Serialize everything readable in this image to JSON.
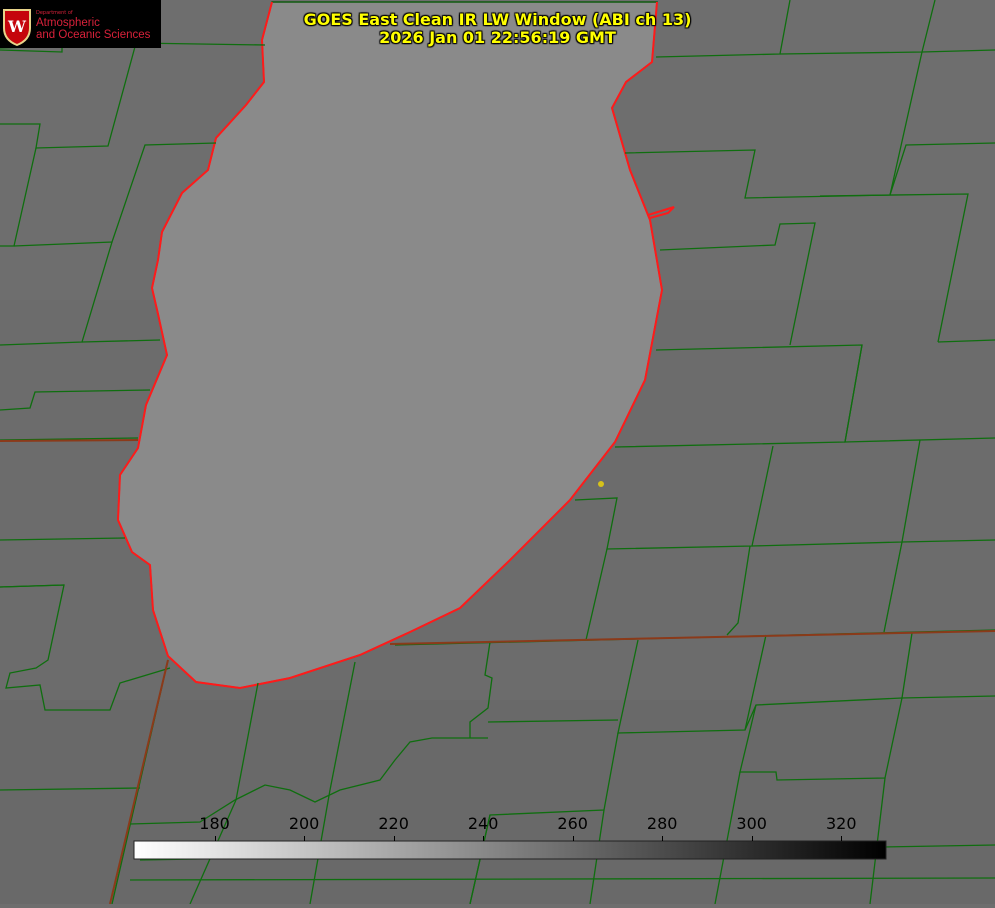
{
  "title": {
    "line1": "GOES East Clean IR LW Window (ABI ch 13)",
    "line2": "2026 Jan 01 22:56:19 GMT"
  },
  "logo": {
    "dept": "Department of",
    "line1": "Atmospheric",
    "line2": "and Oceanic Sciences",
    "emblem": "W"
  },
  "colorbar": {
    "min": 162,
    "max": 330,
    "ticks": [
      "180",
      "200",
      "220",
      "240",
      "260",
      "280",
      "300",
      "320"
    ],
    "gradient": [
      "#ffffff",
      "#000000"
    ]
  },
  "map": {
    "lake_color": "#8a8a8a",
    "land_color": "#6e6e6e",
    "county_line_color": "#0f6e0f",
    "coast_color": "#ff1a1a",
    "marker_color": "#d6c21a"
  }
}
